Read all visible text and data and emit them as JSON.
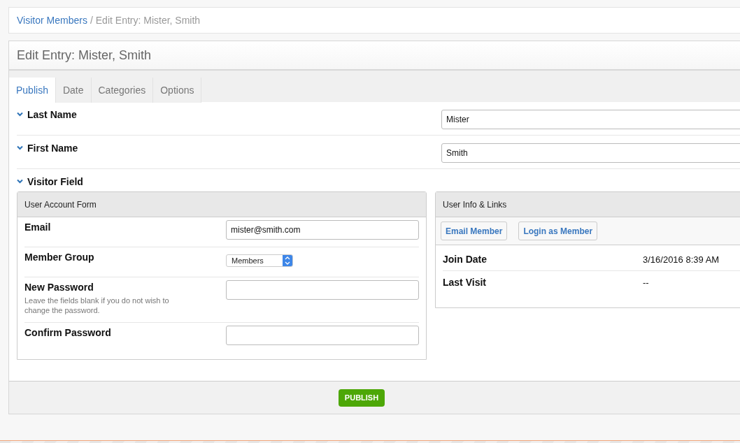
{
  "breadcrumb": {
    "link": "Visitor Members",
    "separator": "/",
    "current": "Edit Entry: Mister, Smith"
  },
  "title": "Edit Entry: Mister, Smith",
  "tabs": [
    {
      "label": "Publish",
      "selected": true
    },
    {
      "label": "Date",
      "selected": false
    },
    {
      "label": "Categories",
      "selected": false
    },
    {
      "label": "Options",
      "selected": false
    }
  ],
  "fields": [
    {
      "label": "Last Name",
      "expanded": true,
      "value": "Mister"
    },
    {
      "label": "First Name",
      "expanded": true,
      "value": "Smith"
    }
  ],
  "visitor_field": {
    "label": "Visitor Field",
    "expanded": true,
    "account_form": {
      "title": "User Account Form",
      "rows": [
        {
          "kind": "text",
          "label": "Email",
          "value": "mister@smith.com"
        },
        {
          "kind": "select",
          "label": "Member Group",
          "value": "Members"
        },
        {
          "kind": "text",
          "label": "New Password",
          "hint": "Leave the fields blank if you do not wish to change the password."
        },
        {
          "kind": "text",
          "label": "Confirm Password"
        }
      ]
    },
    "user_info": {
      "title": "User Info & Links",
      "buttons": [
        "Email Member",
        "Login as Member"
      ],
      "rows": [
        {
          "label": "Join Date",
          "value": "3/16/2016 8:39 AM"
        },
        {
          "label": "Last Visit",
          "value": "--"
        }
      ]
    }
  },
  "publish_button": "PUBLISH"
}
